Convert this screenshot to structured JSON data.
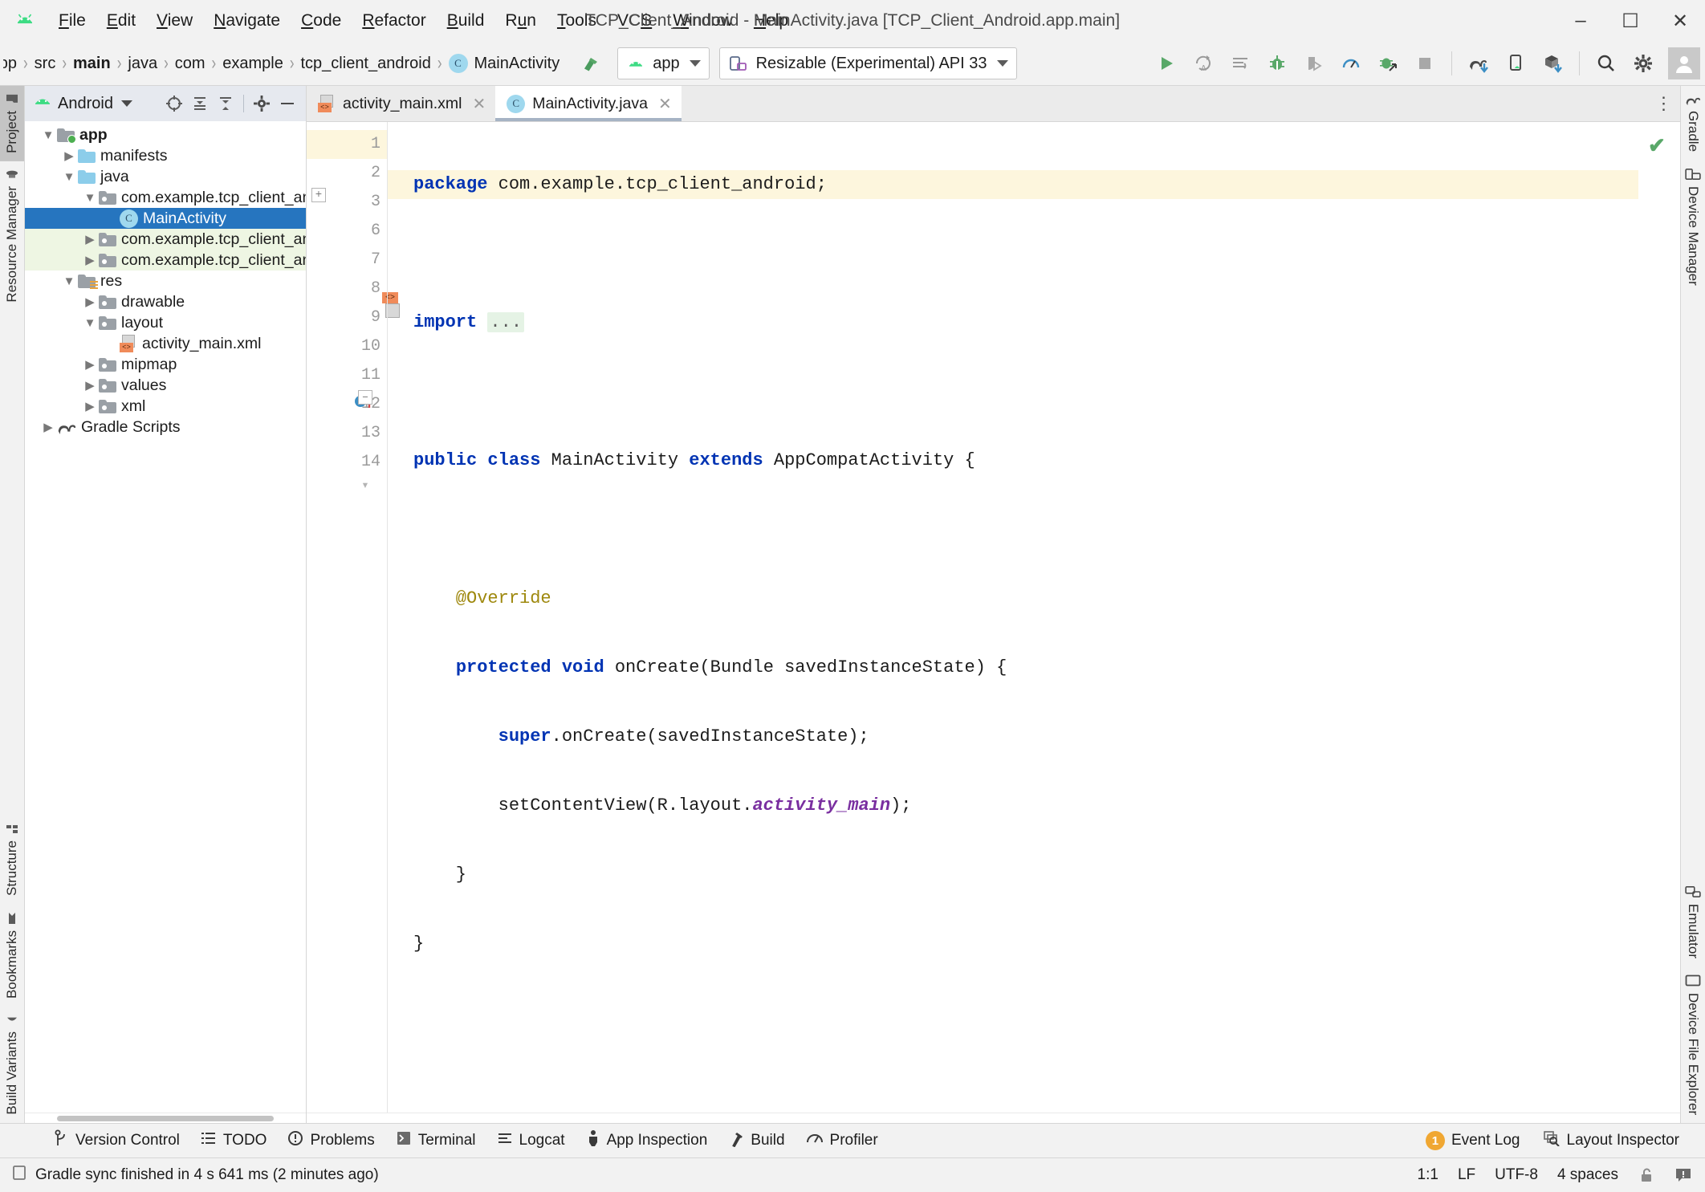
{
  "window": {
    "title": "TCP_Client_Android - MainActivity.java [TCP_Client_Android.app.main]",
    "minimize": "–",
    "maximize": "☐",
    "close": "✕"
  },
  "menu": [
    {
      "label": "File",
      "accel": "F"
    },
    {
      "label": "Edit",
      "accel": "E"
    },
    {
      "label": "View",
      "accel": "V"
    },
    {
      "label": "Navigate",
      "accel": "N"
    },
    {
      "label": "Code",
      "accel": "C"
    },
    {
      "label": "Refactor",
      "accel": "R"
    },
    {
      "label": "Build",
      "accel": "B"
    },
    {
      "label": "Run",
      "accel": "u"
    },
    {
      "label": "Tools",
      "accel": "T"
    },
    {
      "label": "VCS",
      "accel": "S"
    },
    {
      "label": "Window",
      "accel": "W"
    },
    {
      "label": "Help",
      "accel": "H"
    }
  ],
  "breadcrumbs": [
    {
      "label": "app",
      "bold": false,
      "truncated": true
    },
    {
      "label": "src",
      "bold": false
    },
    {
      "label": "main",
      "bold": true
    },
    {
      "label": "java",
      "bold": false
    },
    {
      "label": "com",
      "bold": false
    },
    {
      "label": "example",
      "bold": false
    },
    {
      "label": "tcp_client_android",
      "bold": false
    },
    {
      "label": "MainActivity",
      "bold": false,
      "icon": "class-icon",
      "badge": "C"
    }
  ],
  "toolbar": {
    "module_selector": "app",
    "device_selector": "Resizable (Experimental) API 33",
    "icons": [
      {
        "name": "make-project-icon",
        "glyph": "hammer"
      },
      {
        "name": "run-icon",
        "glyph": "play"
      },
      {
        "name": "apply-changes-icon",
        "glyph": "reload-a"
      },
      {
        "name": "apply-code-changes-icon",
        "glyph": "lines-arrow"
      },
      {
        "name": "debug-icon",
        "glyph": "bug"
      },
      {
        "name": "attach-debugger-icon",
        "glyph": "shield-play"
      },
      {
        "name": "profile-icon",
        "glyph": "gauge"
      },
      {
        "name": "run-with-coverage-icon",
        "glyph": "bug-arrow"
      },
      {
        "name": "stop-icon",
        "glyph": "square"
      },
      {
        "name": "gradle-sync-icon",
        "glyph": "elephant-sync"
      },
      {
        "name": "avd-manager-icon",
        "glyph": "device"
      },
      {
        "name": "sdk-manager-icon",
        "glyph": "box-download"
      },
      {
        "name": "search-everywhere-icon",
        "glyph": "magnifier"
      },
      {
        "name": "settings-icon",
        "glyph": "gear"
      },
      {
        "name": "account-icon",
        "glyph": "person"
      }
    ]
  },
  "left_strip": {
    "top": [
      {
        "label": "Project",
        "icon": "folder-icon",
        "active": true
      },
      {
        "label": "Resource Manager",
        "icon": "resource-icon",
        "active": false
      }
    ],
    "bottom": [
      {
        "label": "Structure",
        "icon": "structure-icon",
        "active": false
      },
      {
        "label": "Bookmarks",
        "icon": "bookmark-icon",
        "active": false
      },
      {
        "label": "Build Variants",
        "icon": "variants-icon",
        "active": false
      }
    ]
  },
  "right_strip": {
    "top": [
      {
        "label": "Gradle",
        "icon": "elephant-icon"
      },
      {
        "label": "Device Manager",
        "icon": "device-manager-icon"
      }
    ],
    "bottom": [
      {
        "label": "Emulator",
        "icon": "emulator-icon"
      },
      {
        "label": "Device File Explorer",
        "icon": "device-file-explorer-icon"
      }
    ]
  },
  "project_panel": {
    "title": "Android",
    "header_icons": [
      {
        "name": "select-opened-file-icon"
      },
      {
        "name": "expand-all-icon"
      },
      {
        "name": "collapse-all-icon"
      },
      {
        "name": "settings-icon"
      },
      {
        "name": "hide-icon"
      }
    ],
    "tree": [
      {
        "label": "app",
        "depth": 0,
        "arrow": "down",
        "icon": "module-folder-icon",
        "bold": true,
        "style": "normal"
      },
      {
        "label": "manifests",
        "depth": 1,
        "arrow": "right",
        "icon": "folder-blue-icon",
        "bold": false,
        "style": "normal"
      },
      {
        "label": "java",
        "depth": 1,
        "arrow": "down",
        "icon": "folder-blue-icon",
        "bold": false,
        "style": "normal"
      },
      {
        "label": "com.example.tcp_client_android",
        "depth": 2,
        "arrow": "down",
        "icon": "package-folder-icon",
        "bold": false,
        "style": "normal"
      },
      {
        "label": "MainActivity",
        "depth": 3,
        "arrow": "none",
        "icon": "class-icon",
        "bold": false,
        "style": "selected"
      },
      {
        "label": "com.example.tcp_client_android (",
        "depth": 2,
        "arrow": "right",
        "icon": "package-folder-icon",
        "bold": false,
        "style": "test"
      },
      {
        "label": "com.example.tcp_client_android (",
        "depth": 2,
        "arrow": "right",
        "icon": "package-folder-icon",
        "bold": false,
        "style": "test"
      },
      {
        "label": "res",
        "depth": 1,
        "arrow": "down",
        "icon": "res-folder-icon",
        "bold": false,
        "style": "normal"
      },
      {
        "label": "drawable",
        "depth": 2,
        "arrow": "right",
        "icon": "package-folder-icon",
        "bold": false,
        "style": "normal"
      },
      {
        "label": "layout",
        "depth": 2,
        "arrow": "down",
        "icon": "package-folder-icon",
        "bold": false,
        "style": "normal"
      },
      {
        "label": "activity_main.xml",
        "depth": 3,
        "arrow": "none",
        "icon": "xml-layout-icon",
        "bold": false,
        "style": "normal"
      },
      {
        "label": "mipmap",
        "depth": 2,
        "arrow": "right",
        "icon": "package-folder-icon",
        "bold": false,
        "style": "normal"
      },
      {
        "label": "values",
        "depth": 2,
        "arrow": "right",
        "icon": "package-folder-icon",
        "bold": false,
        "style": "normal"
      },
      {
        "label": "xml",
        "depth": 2,
        "arrow": "right",
        "icon": "package-folder-icon",
        "bold": false,
        "style": "normal"
      },
      {
        "label": "Gradle Scripts",
        "depth": 0,
        "arrow": "right",
        "icon": "elephant-icon",
        "bold": false,
        "style": "normal"
      }
    ]
  },
  "editor": {
    "tabs": [
      {
        "label": "activity_main.xml",
        "icon": "xml-layout-icon",
        "active": false,
        "close": "✕"
      },
      {
        "label": "MainActivity.java",
        "icon": "class-icon",
        "active": true,
        "close": "✕"
      }
    ],
    "more_glyph": "⋮",
    "inspection_status": "✔",
    "lines": [
      {
        "num": "1",
        "highlight": true,
        "segments": [
          {
            "t": "package",
            "c": "kw"
          },
          {
            "t": " com.example.tcp_client_android;",
            "c": "plain"
          }
        ]
      },
      {
        "num": "2",
        "highlight": false,
        "segments": []
      },
      {
        "num": "3",
        "highlight": false,
        "fold": "plus",
        "segments": [
          {
            "t": "import",
            "c": "kw"
          },
          {
            "t": " ",
            "c": "plain"
          },
          {
            "t": "...",
            "c": "dots"
          }
        ]
      },
      {
        "num": "6",
        "highlight": false,
        "segments": []
      },
      {
        "num": "7",
        "highlight": false,
        "mark": "xml-layout-icon",
        "segments": [
          {
            "t": "public class",
            "c": "kw"
          },
          {
            "t": " MainActivity ",
            "c": "plain"
          },
          {
            "t": "extends",
            "c": "kw"
          },
          {
            "t": " AppCompatActivity {",
            "c": "plain"
          }
        ]
      },
      {
        "num": "8",
        "highlight": false,
        "segments": []
      },
      {
        "num": "9",
        "highlight": false,
        "segments": [
          {
            "t": "    @Override",
            "c": "anno"
          }
        ]
      },
      {
        "num": "10",
        "highlight": false,
        "mark": "run-gutter-icon",
        "fold": "minus",
        "segments": [
          {
            "t": "    ",
            "c": "plain"
          },
          {
            "t": "protected void",
            "c": "kw"
          },
          {
            "t": " onCreate(Bundle savedInstanceState) {",
            "c": "plain"
          }
        ]
      },
      {
        "num": "11",
        "highlight": false,
        "segments": [
          {
            "t": "        ",
            "c": "plain"
          },
          {
            "t": "super",
            "c": "kw"
          },
          {
            "t": ".onCreate(savedInstanceState);",
            "c": "plain"
          }
        ]
      },
      {
        "num": "12",
        "highlight": false,
        "segments": [
          {
            "t": "        setContentView(R.layout.",
            "c": "plain"
          },
          {
            "t": "activity_main",
            "c": "fld"
          },
          {
            "t": ");",
            "c": "plain"
          }
        ]
      },
      {
        "num": "13",
        "highlight": false,
        "fold": "brace",
        "segments": [
          {
            "t": "    }",
            "c": "plain"
          }
        ]
      },
      {
        "num": "14",
        "highlight": false,
        "segments": [
          {
            "t": "}",
            "c": "plain"
          }
        ]
      }
    ]
  },
  "tool_windows": [
    {
      "label": "Version Control",
      "icon": "branch-icon"
    },
    {
      "label": "TODO",
      "icon": "todo-icon"
    },
    {
      "label": "Problems",
      "icon": "problems-icon"
    },
    {
      "label": "Terminal",
      "icon": "terminal-icon"
    },
    {
      "label": "Logcat",
      "icon": "logcat-icon"
    },
    {
      "label": "App Inspection",
      "icon": "app-inspection-icon"
    },
    {
      "label": "Build",
      "icon": "build-icon"
    },
    {
      "label": "Profiler",
      "icon": "profiler-icon"
    }
  ],
  "tool_windows_right": [
    {
      "label": "Event Log",
      "icon": "event-log-icon",
      "badge": "1"
    },
    {
      "label": "Layout Inspector",
      "icon": "layout-inspector-icon",
      "badge": ""
    }
  ],
  "status_bar": {
    "message": "Gradle sync finished in 4 s 641 ms (2 minutes ago)",
    "message_icon": "console-icon",
    "caret_position": "1:1",
    "line_separator": "LF",
    "encoding": "UTF-8",
    "indent": "4 spaces",
    "lock_icon": "unlocked-icon",
    "notify_icon": "notification-icon"
  },
  "colors": {
    "selection_blue": "#2675bf",
    "test_green": "#eef6e3",
    "highlight_line": "#fdf6dd",
    "accent_green": "#3ddc84",
    "keyword_blue": "#0033b3",
    "annotation_olive": "#9e880d",
    "field_purple": "#7a2fa0",
    "badge_orange": "#f0a732"
  }
}
